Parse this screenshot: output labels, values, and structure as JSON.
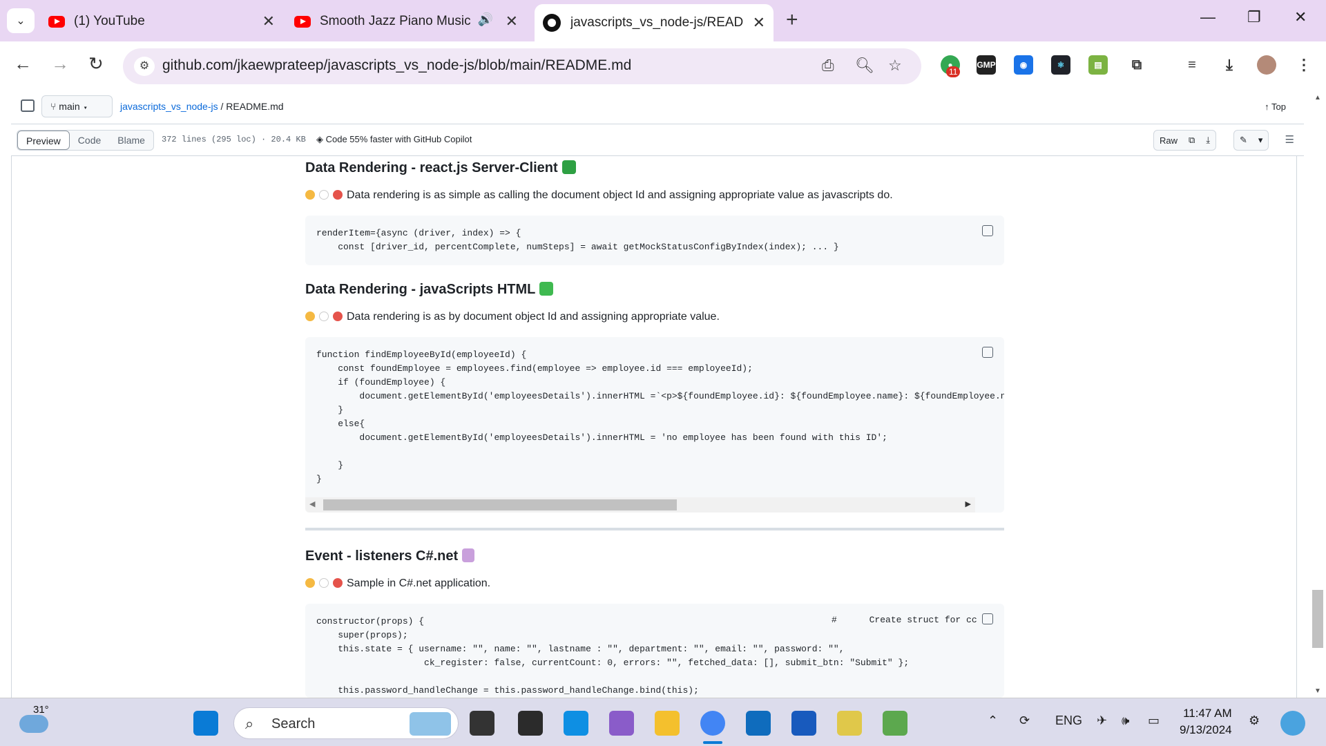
{
  "browser": {
    "tabs": [
      {
        "title": "(1) YouTube",
        "favicon": "youtube-icon"
      },
      {
        "title": "Smooth Jazz Piano Music fo",
        "favicon": "youtube-icon",
        "audio": true
      },
      {
        "title": "javascripts_vs_node-js/READM",
        "favicon": "github-icon",
        "active": true
      }
    ],
    "url": "github.com/jkaewprateep/javascripts_vs_node-js/blob/main/README.md",
    "extension_badge": "11",
    "extensions": [
      "GMP"
    ]
  },
  "github": {
    "branch": "main",
    "repo_link": "javascripts_vs_node-js",
    "separator": "/",
    "file_name": "README.md",
    "top_label": "Top",
    "view_tabs": [
      "Preview",
      "Code",
      "Blame"
    ],
    "file_meta": "372 lines (295 loc) · 20.4 KB",
    "copilot": "Code 55% faster with GitHub Copilot",
    "raw_label": "Raw"
  },
  "readme": {
    "sections": [
      {
        "heading": "Data Rendering - react.js Server-Client",
        "desc": "Data rendering is as simple as calling the document object Id and assigning appropriate value as javascripts do.",
        "code": "renderItem={async (driver, index) => {\n    const [driver_id, percentComplete, numSteps] = await getMockStatusConfigByIndex(index); ... }"
      },
      {
        "heading": "Data Rendering - javaScripts HTML",
        "desc": "Data rendering is as by document object Id and assigning appropriate value.",
        "code": "function findEmployeeById(employeeId) {\n    const foundEmployee = employees.find(employee => employee.id === employeeId);\n    if (foundEmployee) {\n        document.getElementById('employeesDetails').innerHTML =`<p>${foundEmployee.id}: ${foundEmployee.name}: ${foundEmployee.n\n    }\n    else{\n        document.getElementById('employeesDetails').innerHTML = 'no employee has been found with this ID';\n\n    }\n}"
      },
      {
        "heading": "Event - listeners C#.net",
        "desc": "Sample in C#.net application.",
        "code": "constructor(props) {\n    super(props);\n    this.state = { username: \"\", name: \"\", lastname : \"\", department: \"\", email: \"\", password: \"\",\n                    ck_register: false, currentCount: 0, errors: \"\", fetched_data: [], submit_btn: \"Submit\" };\n\n    this.password_handleChange = this.password_handleChange.bind(this);",
        "comment": "#      Create struct for cc"
      }
    ]
  },
  "taskbar": {
    "weather": "31°",
    "search_placeholder": "Search",
    "language": "ENG",
    "time": "11:47 AM",
    "date": "9/13/2024"
  },
  "colors": {
    "tab_strip": "#e9d7f3",
    "link": "#0969da",
    "code_bg": "#f6f8fa"
  }
}
